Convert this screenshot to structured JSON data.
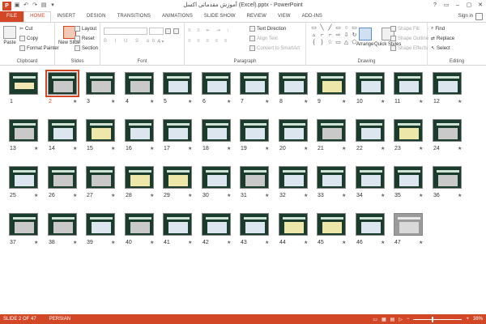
{
  "window": {
    "app_logo": "P",
    "title": "آموزش مقدماتی اکسل (Excel).pptx - PowerPoint",
    "controls": [
      "?",
      "▭",
      "–",
      "▢",
      "✕"
    ]
  },
  "tabs": [
    "FILE",
    "HOME",
    "INSERT",
    "DESIGN",
    "TRANSITIONS",
    "ANIMATIONS",
    "SLIDE SHOW",
    "REVIEW",
    "VIEW",
    "ADD-INS"
  ],
  "active_tab": "HOME",
  "signin": "Sign in",
  "ribbon": {
    "clipboard": {
      "label": "Clipboard",
      "paste": "Paste",
      "cut": "Cut",
      "copy": "Copy",
      "format_painter": "Format Painter"
    },
    "slides": {
      "label": "Slides",
      "new_slide": "New Slide",
      "layout": "Layout",
      "reset": "Reset",
      "section": "Section"
    },
    "font": {
      "label": "Font"
    },
    "paragraph": {
      "label": "Paragraph",
      "text_direction": "Text Direction",
      "align_text": "Align Text",
      "convert": "Convert to SmartArt"
    },
    "drawing": {
      "label": "Drawing",
      "arrange": "Arrange",
      "quick_styles": "Quick Styles",
      "shape_fill": "Shape Fill",
      "shape_outline": "Shape Outline",
      "shape_effects": "Shape Effects"
    },
    "editing": {
      "label": "Editing",
      "find": "Find",
      "replace": "Replace",
      "select": "Select"
    }
  },
  "slides": [
    {
      "n": "1",
      "t": "title"
    },
    {
      "n": "2",
      "t": "img"
    },
    {
      "n": "3",
      "t": "img"
    },
    {
      "n": "4",
      "t": "img"
    },
    {
      "n": "5",
      "t": "text"
    },
    {
      "n": "6",
      "t": "text"
    },
    {
      "n": "7",
      "t": "text"
    },
    {
      "n": "8",
      "t": "text"
    },
    {
      "n": "9",
      "t": "table"
    },
    {
      "n": "10",
      "t": "text"
    },
    {
      "n": "11",
      "t": "text"
    },
    {
      "n": "12",
      "t": "text"
    },
    {
      "n": "13",
      "t": "img"
    },
    {
      "n": "14",
      "t": "text"
    },
    {
      "n": "15",
      "t": "table"
    },
    {
      "n": "16",
      "t": "text"
    },
    {
      "n": "17",
      "t": "text"
    },
    {
      "n": "18",
      "t": "text"
    },
    {
      "n": "19",
      "t": "text"
    },
    {
      "n": "20",
      "t": "text"
    },
    {
      "n": "21",
      "t": "img"
    },
    {
      "n": "22",
      "t": "text"
    },
    {
      "n": "23",
      "t": "table"
    },
    {
      "n": "24",
      "t": "img"
    },
    {
      "n": "25",
      "t": "text"
    },
    {
      "n": "26",
      "t": "img"
    },
    {
      "n": "27",
      "t": "img"
    },
    {
      "n": "28",
      "t": "table"
    },
    {
      "n": "29",
      "t": "table"
    },
    {
      "n": "30",
      "t": "text"
    },
    {
      "n": "31",
      "t": "img"
    },
    {
      "n": "32",
      "t": "text"
    },
    {
      "n": "33",
      "t": "text"
    },
    {
      "n": "34",
      "t": "text"
    },
    {
      "n": "35",
      "t": "text"
    },
    {
      "n": "36",
      "t": "img"
    },
    {
      "n": "37",
      "t": "img"
    },
    {
      "n": "38",
      "t": "img"
    },
    {
      "n": "39",
      "t": "text"
    },
    {
      "n": "40",
      "t": "img"
    },
    {
      "n": "41",
      "t": "text"
    },
    {
      "n": "42",
      "t": "text"
    },
    {
      "n": "43",
      "t": "text"
    },
    {
      "n": "44",
      "t": "table"
    },
    {
      "n": "45",
      "t": "table"
    },
    {
      "n": "46",
      "t": "text"
    },
    {
      "n": "47",
      "t": "gray"
    }
  ],
  "selected_slide": "2",
  "status": {
    "slide_info": "SLIDE 2 OF 47",
    "language": "PERSIAN",
    "zoom": "38%",
    "zoom_level": 0.38
  },
  "colors": {
    "accent": "#d24726",
    "slide_bg": "#1b3c2c"
  }
}
